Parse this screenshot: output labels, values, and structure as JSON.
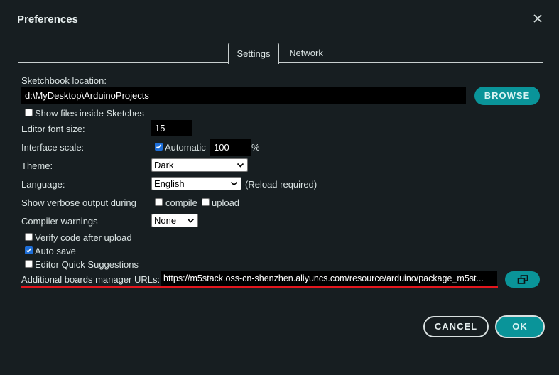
{
  "dialog": {
    "title": "Preferences",
    "close_icon": "close-icon"
  },
  "tabs": [
    {
      "label": "Settings",
      "active": true
    },
    {
      "label": "Network",
      "active": false
    }
  ],
  "sketchbook": {
    "label": "Sketchbook location:",
    "value": "d:\\MyDesktop\\ArduinoProjects",
    "browse_label": "BROWSE",
    "show_files_label": "Show files inside Sketches",
    "show_files_checked": false
  },
  "editor_font": {
    "label": "Editor font size:",
    "value": "15"
  },
  "interface_scale": {
    "label": "Interface scale:",
    "automatic_label": "Automatic",
    "automatic_checked": true,
    "value": "100",
    "unit": "%"
  },
  "theme": {
    "label": "Theme:",
    "selected": "Dark"
  },
  "language": {
    "label": "Language:",
    "selected": "English",
    "note": "(Reload required)"
  },
  "verbose": {
    "label": "Show verbose output during",
    "compile_label": "compile",
    "compile_checked": false,
    "upload_label": "upload",
    "upload_checked": false
  },
  "compiler_warnings": {
    "label": "Compiler warnings",
    "selected": "None"
  },
  "options": {
    "verify_label": "Verify code after upload",
    "verify_checked": false,
    "autosave_label": "Auto save",
    "autosave_checked": true,
    "quick_suggestions_label": "Editor Quick Suggestions",
    "quick_suggestions_checked": false
  },
  "boards_urls": {
    "label": "Additional boards manager URLs:",
    "value": "https://m5stack.oss-cn-shenzhen.aliyuncs.com/resource/arduino/package_m5st...",
    "edit_icon": "open-window-icon"
  },
  "footer": {
    "cancel_label": "CANCEL",
    "ok_label": "OK"
  },
  "colors": {
    "background": "#171e21",
    "accent": "#0a9499",
    "highlight": "#e3161d",
    "checkbox_checked": "#1e6fd9"
  }
}
